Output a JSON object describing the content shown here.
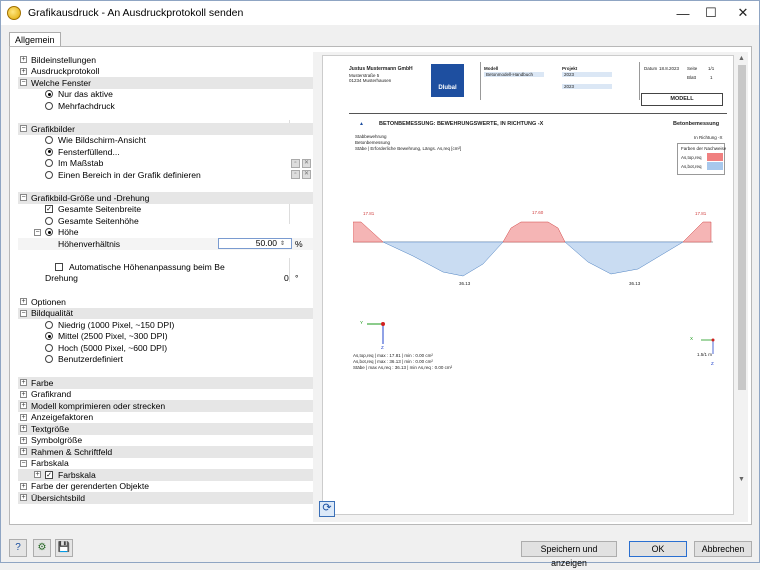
{
  "window": {
    "title": "Grafikausdruck - An Ausdruckprotokoll senden",
    "minimize": "—",
    "maximize": "☐",
    "close": "✕"
  },
  "tabs": [
    {
      "label": "Allgemein"
    }
  ],
  "tree": {
    "bildeinstellungen": "Bildeinstellungen",
    "ausdruckprotokoll": "Ausdruckprotokoll",
    "welche_fenster": "Welche Fenster",
    "nur_das_aktive": "Nur das aktive",
    "mehrfachdruck": "Mehrfachdruck",
    "grafikbilder": "Grafikbilder",
    "wie_bildschirm": "Wie Bildschirm-Ansicht",
    "fensterfuellend": "Fensterfüllend...",
    "im_massstab": "Im Maßstab",
    "einen_bereich": "Einen Bereich in der Grafik definieren",
    "groesse_drehung": "Grafikbild-Größe und -Drehung",
    "gesamte_seitenbreite": "Gesamte Seitenbreite",
    "gesamte_seitenhoehe": "Gesamte Seitenhöhe",
    "hoehe": "Höhe",
    "hoehenverhaeltnis": "Höhenverhältnis",
    "hoehenverhaeltnis_value": "50.00",
    "hoehenverhaeltnis_unit": "%",
    "auto_hoehenanpassung": "Automatische Höhenanpassung beim Be",
    "drehung": "Drehung",
    "drehung_value": "0",
    "drehung_unit": "°",
    "optionen": "Optionen",
    "bildqualitaet": "Bildqualität",
    "niedrig": "Niedrig (1000 Pixel, ~150 DPI)",
    "mittel": "Mittel (2500 Pixel, ~300 DPI)",
    "hoch": "Hoch (5000 Pixel, ~600 DPI)",
    "benutzerdefiniert": "Benutzerdefiniert",
    "farbe": "Farbe",
    "grafikrand": "Grafikrand",
    "modell_komprimieren": "Modell komprimieren oder strecken",
    "anzeigefaktoren": "Anzeigefaktoren",
    "textgroesse": "Textgröße",
    "symbolgroesse": "Symbolgröße",
    "rahmen_schriftfeld": "Rahmen & Schriftfeld",
    "farbskala": "Farbskala",
    "farbskala_item": "Farbskala",
    "farbe_gerenderte": "Farbe der gerenderten Objekte",
    "uebersichtsbild": "Übersichtsbild"
  },
  "preview": {
    "company": "Justus Mustermann GmbH",
    "address1": "Musterstraße 5",
    "address2": "01234 Musterhausen",
    "logo_text": "Dlubal",
    "modell_label": "Modell",
    "modell_value": "Betonmodell-Handbuch",
    "projekt_label": "Projekt",
    "projekt_value1": "2023",
    "projekt_value2": "2023",
    "datum_label": "Datum",
    "datum_value": "18.8.2023",
    "seite_label": "Seite",
    "seite_value": "1/1",
    "blatt_label": "Blatt",
    "blatt_value": "1",
    "modell_box": "MODELL",
    "section_heading": "BETONBEMESSUNG: BEWEHRUNGSWERTE, IN RICHTUNG -X",
    "section_right": "Betonbemessung",
    "sub1": "Stabbewehrung",
    "sub2": "Betonbemessung",
    "sub3": "Stäbe | Erforderliche Bewehrung, Längs. As,req [cm²]",
    "richtung": "In Richtung -X",
    "legend_title": "Farben der Nachweise",
    "legend_1": "As,top,req",
    "legend_2": "As,bot,req",
    "val_top_left": "17.81",
    "val_top_mid": "17.60",
    "val_top_right": "17.81",
    "val_bot_left": "36.13",
    "val_bot_right": "36.13",
    "axis_y": "Y",
    "axis_z": "Z",
    "axis_x": "X",
    "scale": "1.5/1 m",
    "foot1": "As,top,req | max : 17.81 | min : 0.00 cm²",
    "foot2": "As,bot,req | max : 36.13 | min : 0.00 cm²",
    "foot3": "Stäbe | max As,req : 36.13 | min As,req : 0.00 cm²"
  },
  "buttons": {
    "save_show": "Speichern und anzeigen",
    "ok": "OK",
    "cancel": "Abbrechen"
  },
  "icons": {
    "refresh": "⟳",
    "help": "?",
    "units": "⚙",
    "save": "💾"
  }
}
